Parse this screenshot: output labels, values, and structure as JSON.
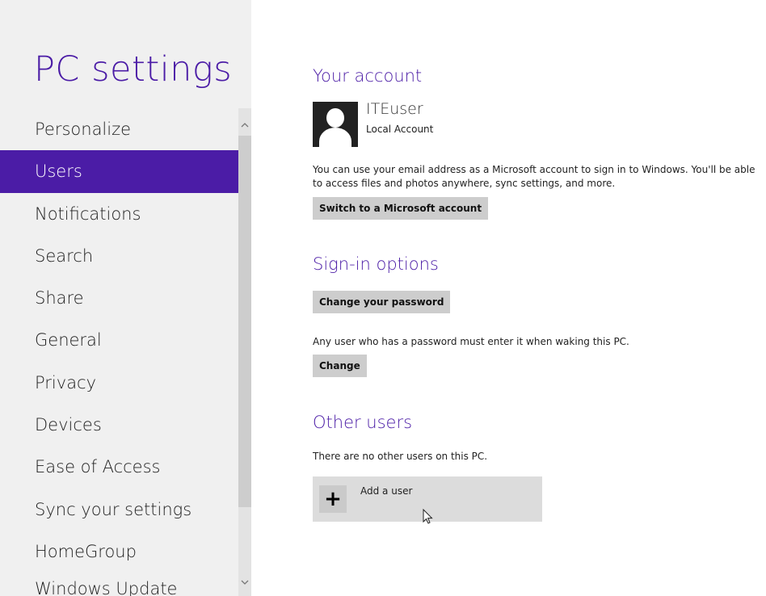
{
  "sidebar": {
    "title": "PC settings",
    "items": [
      {
        "label": "Personalize"
      },
      {
        "label": "Users"
      },
      {
        "label": "Notifications"
      },
      {
        "label": "Search"
      },
      {
        "label": "Share"
      },
      {
        "label": "General"
      },
      {
        "label": "Privacy"
      },
      {
        "label": "Devices"
      },
      {
        "label": "Ease of Access"
      },
      {
        "label": "Sync your settings"
      },
      {
        "label": "HomeGroup"
      },
      {
        "label": "Windows Update"
      }
    ],
    "selected": "Users"
  },
  "account": {
    "section_title": "Your account",
    "user_name": "ITEuser",
    "account_type": "Local Account",
    "description_line1": "You can use your email address as a Microsoft account to sign in to Windows. You'll be able",
    "description_line2": "to access files and photos anywhere, sync settings, and more.",
    "switch_button": "Switch to a Microsoft account"
  },
  "signin": {
    "section_title": "Sign-in options",
    "change_password_button": "Change your password",
    "wake_text": "Any user who has a password must enter it when waking this PC.",
    "change_button": "Change"
  },
  "other_users": {
    "section_title": "Other users",
    "empty_text": "There are no other users on this PC.",
    "add_user_label": "Add a user",
    "add_icon_glyph": "+"
  },
  "colors": {
    "accent": "#4b1ca6",
    "sidebar_bg": "#f0f0f0",
    "button_bg": "#cdcdcd"
  },
  "icons": [
    "user-avatar-icon",
    "plus-icon",
    "chevron-up-icon",
    "chevron-down-icon",
    "mouse-cursor-icon"
  ]
}
